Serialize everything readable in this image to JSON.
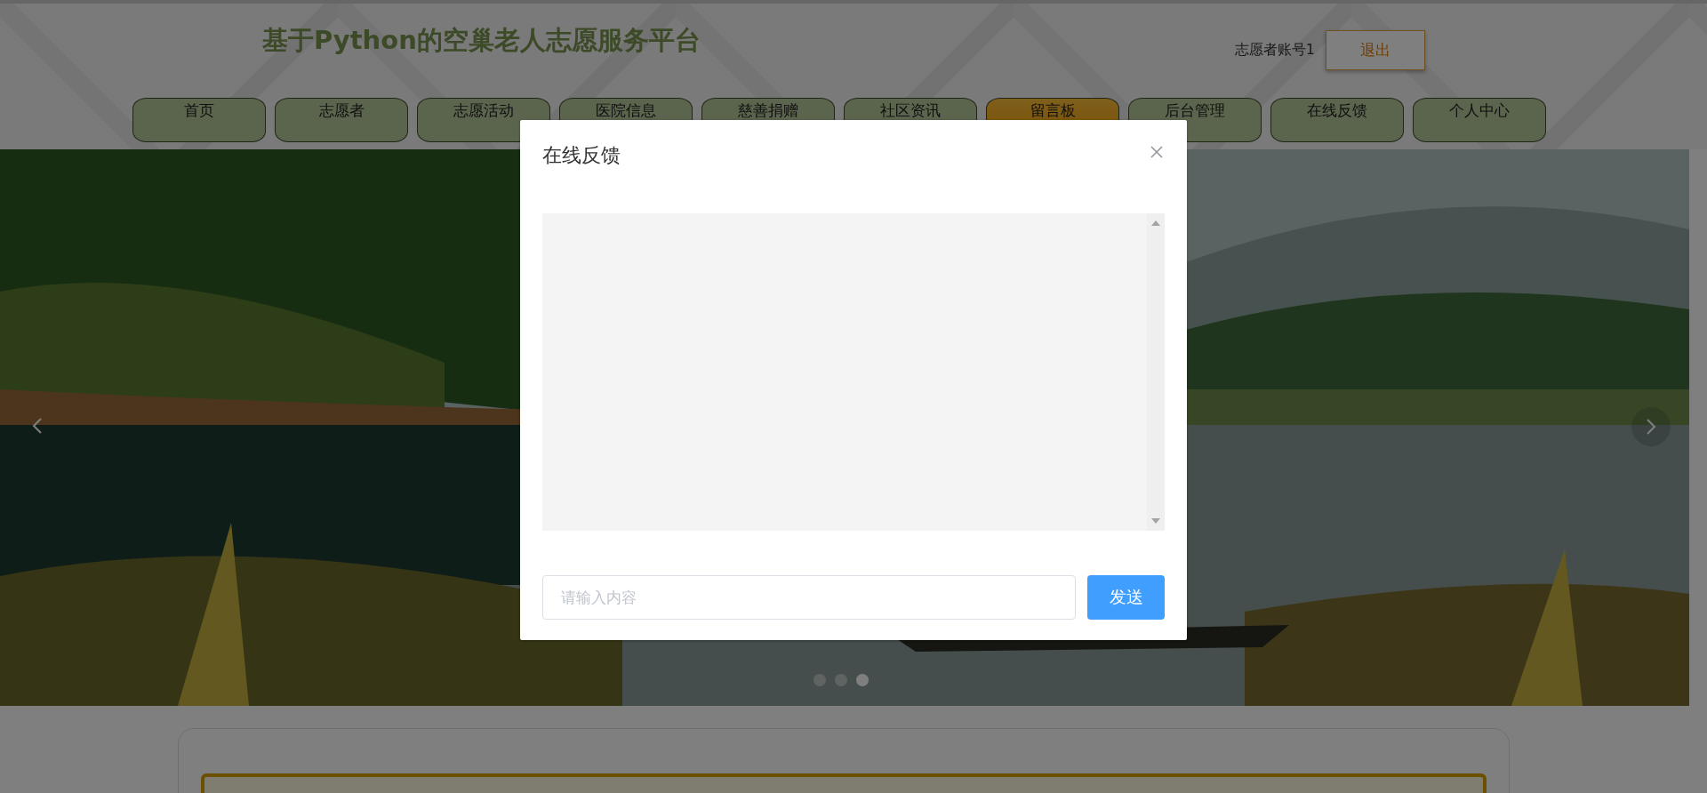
{
  "header": {
    "title": "基于Python的空巢老人志愿服务平台",
    "account": "志愿者账号1",
    "logout": "退出"
  },
  "nav": [
    {
      "label": "首页",
      "selected": false
    },
    {
      "label": "志愿者",
      "selected": false
    },
    {
      "label": "志愿活动",
      "selected": false
    },
    {
      "label": "医院信息",
      "selected": false
    },
    {
      "label": "慈善捐赠",
      "selected": false
    },
    {
      "label": "社区资讯",
      "selected": false
    },
    {
      "label": "留言板",
      "selected": true
    },
    {
      "label": "后台管理",
      "selected": false
    },
    {
      "label": "在线反馈",
      "selected": false
    },
    {
      "label": "个人中心",
      "selected": false
    }
  ],
  "carousel": {
    "kind": "picture",
    "dots": [
      {
        "selected": false
      },
      {
        "selected": false
      },
      {
        "selected": true
      }
    ]
  },
  "dialog": {
    "title": "在线反馈",
    "input": {
      "placeholder": "请输入内容"
    },
    "send": "发送"
  }
}
